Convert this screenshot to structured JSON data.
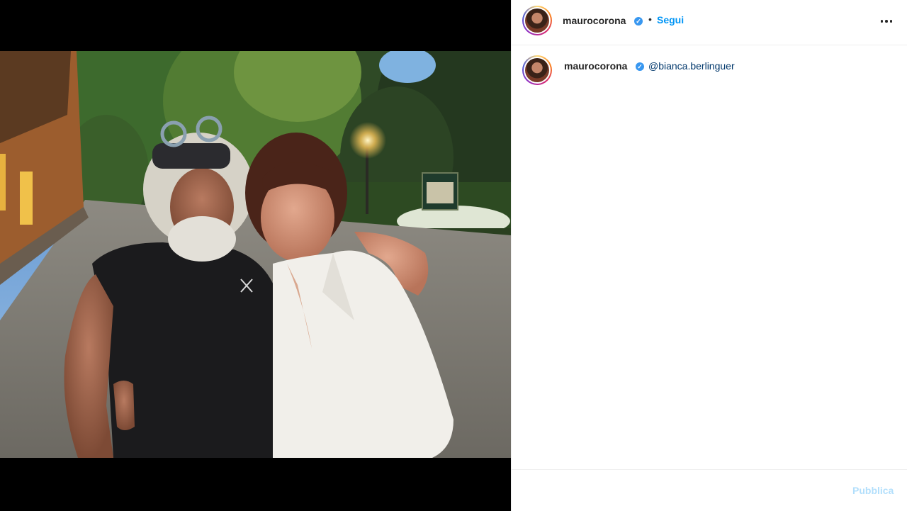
{
  "post": {
    "author": "maurocorona",
    "verified": true,
    "follow_label": "Segui",
    "separator": "•",
    "more_icon": "more-horizontal-icon"
  },
  "caption": {
    "author": "maurocorona",
    "mention": "@bianca.berlinguer"
  },
  "comment": {
    "placeholder": "",
    "publish_label": "Pubblica"
  },
  "colors": {
    "link_blue": "#0095f6",
    "mention_blue": "#00376b",
    "publish_disabled": "#b2dffc",
    "verified_blue": "#3897f0"
  }
}
